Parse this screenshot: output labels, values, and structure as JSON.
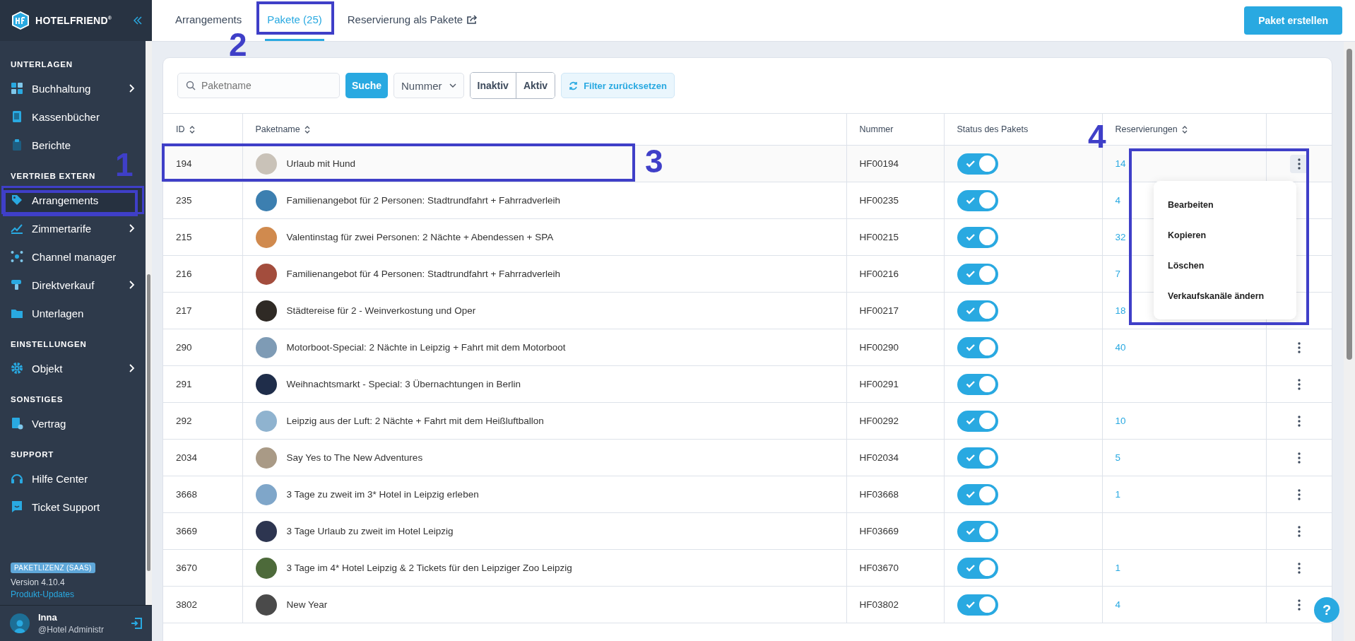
{
  "sidebar": {
    "logo": "HOTELFRIEND",
    "logo_mark": "®",
    "sections": [
      {
        "heading": "UNTERLAGEN",
        "items": [
          {
            "label": "Buchhaltung",
            "selected": false,
            "has_submenu": true
          },
          {
            "label": "Kassenbücher",
            "selected": false,
            "has_submenu": false
          },
          {
            "label": "Berichte",
            "selected": false,
            "has_submenu": false
          }
        ]
      },
      {
        "heading": "VERTRIEB EXTERN",
        "items": [
          {
            "label": "Arrangements",
            "selected": true,
            "has_submenu": false
          },
          {
            "label": "Zimmertarife",
            "selected": false,
            "has_submenu": true
          },
          {
            "label": "Channel manager",
            "selected": false,
            "has_submenu": false
          },
          {
            "label": "Direktverkauf",
            "selected": false,
            "has_submenu": true
          },
          {
            "label": "Unterlagen",
            "selected": false,
            "has_submenu": false
          }
        ]
      },
      {
        "heading": "EINSTELLUNGEN",
        "items": [
          {
            "label": "Objekt",
            "selected": false,
            "has_submenu": true
          }
        ]
      },
      {
        "heading": "SONSTIGES",
        "items": [
          {
            "label": "Vertrag",
            "selected": false,
            "has_submenu": false
          }
        ]
      },
      {
        "heading": "SUPPORT",
        "items": [
          {
            "label": "Hilfe Center",
            "selected": false,
            "has_submenu": false
          },
          {
            "label": "Ticket Support",
            "selected": false,
            "has_submenu": false
          }
        ]
      }
    ],
    "license_badge": "PAKETLIZENZ (SAAS)",
    "version": "Version 4.10.4",
    "updates_link": "Produkt-Updates",
    "user": {
      "name": "Inna",
      "role": "@Hotel Administr"
    }
  },
  "tabs": [
    {
      "label": "Arrangements",
      "selected": false
    },
    {
      "label": "Pakete (25)",
      "selected": true
    },
    {
      "label": "Reservierung als Pakete",
      "selected": false
    }
  ],
  "create_button": "Paket erstellen",
  "filters": {
    "search": {
      "placeholder": "Paketname"
    },
    "search_button": "Suche",
    "sort_select": "Nummer",
    "segments": [
      "Inaktiv",
      "Aktiv"
    ],
    "reset_button": "Filter zurücksetzen"
  },
  "table": {
    "columns": [
      {
        "label": "ID",
        "sortable": true
      },
      {
        "label": "Paketname",
        "sortable": true
      },
      {
        "label": "Nummer",
        "sortable": false
      },
      {
        "label": "Status des Pakets",
        "sortable": false
      },
      {
        "label": "Reservierungen",
        "sortable": true
      }
    ],
    "rows": [
      {
        "id": "194",
        "name": "Urlaub mit Hund",
        "number": "HF00194",
        "active": true,
        "reservations": "14",
        "menu_open": true
      },
      {
        "id": "235",
        "name": "Familienangebot für 2 Personen: Stadtrundfahrt + Fahrradverleih",
        "number": "HF00235",
        "active": true,
        "reservations": "4",
        "menu_open": false
      },
      {
        "id": "215",
        "name": "Valentinstag für zwei Personen: 2 Nächte + Abendessen + SPA",
        "number": "HF00215",
        "active": true,
        "reservations": "32",
        "menu_open": false
      },
      {
        "id": "216",
        "name": "Familienangebot für 4 Personen: Stadtrundfahrt + Fahrradverleih",
        "number": "HF00216",
        "active": true,
        "reservations": "7",
        "menu_open": false
      },
      {
        "id": "217",
        "name": "Städtereise für 2 - Weinverkostung und Oper",
        "number": "HF00217",
        "active": true,
        "reservations": "18",
        "menu_open": false
      },
      {
        "id": "290",
        "name": "Motorboot-Special: 2 Nächte in Leipzig + Fahrt mit dem Motorboot",
        "number": "HF00290",
        "active": true,
        "reservations": "40",
        "menu_open": false
      },
      {
        "id": "291",
        "name": "Weihnachtsmarkt - Special: 3 Übernachtungen in Berlin",
        "number": "HF00291",
        "active": true,
        "menu_open": false
      },
      {
        "id": "292",
        "name": "Leipzig aus der Luft: 2 Nächte + Fahrt mit dem Heißluftballon",
        "number": "HF00292",
        "active": true,
        "reservations": "10",
        "menu_open": false
      },
      {
        "id": "2034",
        "name": "Say Yes to The New Adventures",
        "number": "HF02034",
        "active": true,
        "reservations": "5",
        "menu_open": false
      },
      {
        "id": "3668",
        "name": "3 Tage zu zweit im 3* Hotel in Leipzig erleben",
        "number": "HF03668",
        "active": true,
        "reservations": "1",
        "menu_open": false
      },
      {
        "id": "3669",
        "name": "3 Tage Urlaub zu zweit im Hotel Leipzig",
        "number": "HF03669",
        "active": true,
        "menu_open": false
      },
      {
        "id": "3670",
        "name": "3 Tage im 4* Hotel Leipzig & 2 Tickets für den Leipziger Zoo Leipzig",
        "number": "HF03670",
        "active": true,
        "reservations": "1",
        "menu_open": false
      },
      {
        "id": "3802",
        "name": "New Year",
        "number": "HF03802",
        "active": true,
        "reservations": "4",
        "menu_open": false
      }
    ],
    "row_menu": [
      "Bearbeiten",
      "Kopieren",
      "Löschen",
      "Verkaufskanäle ändern"
    ]
  },
  "help_button": "?",
  "annotations": [
    {
      "label": "1"
    },
    {
      "label": "2"
    },
    {
      "label": "3"
    },
    {
      "label": "4"
    }
  ]
}
